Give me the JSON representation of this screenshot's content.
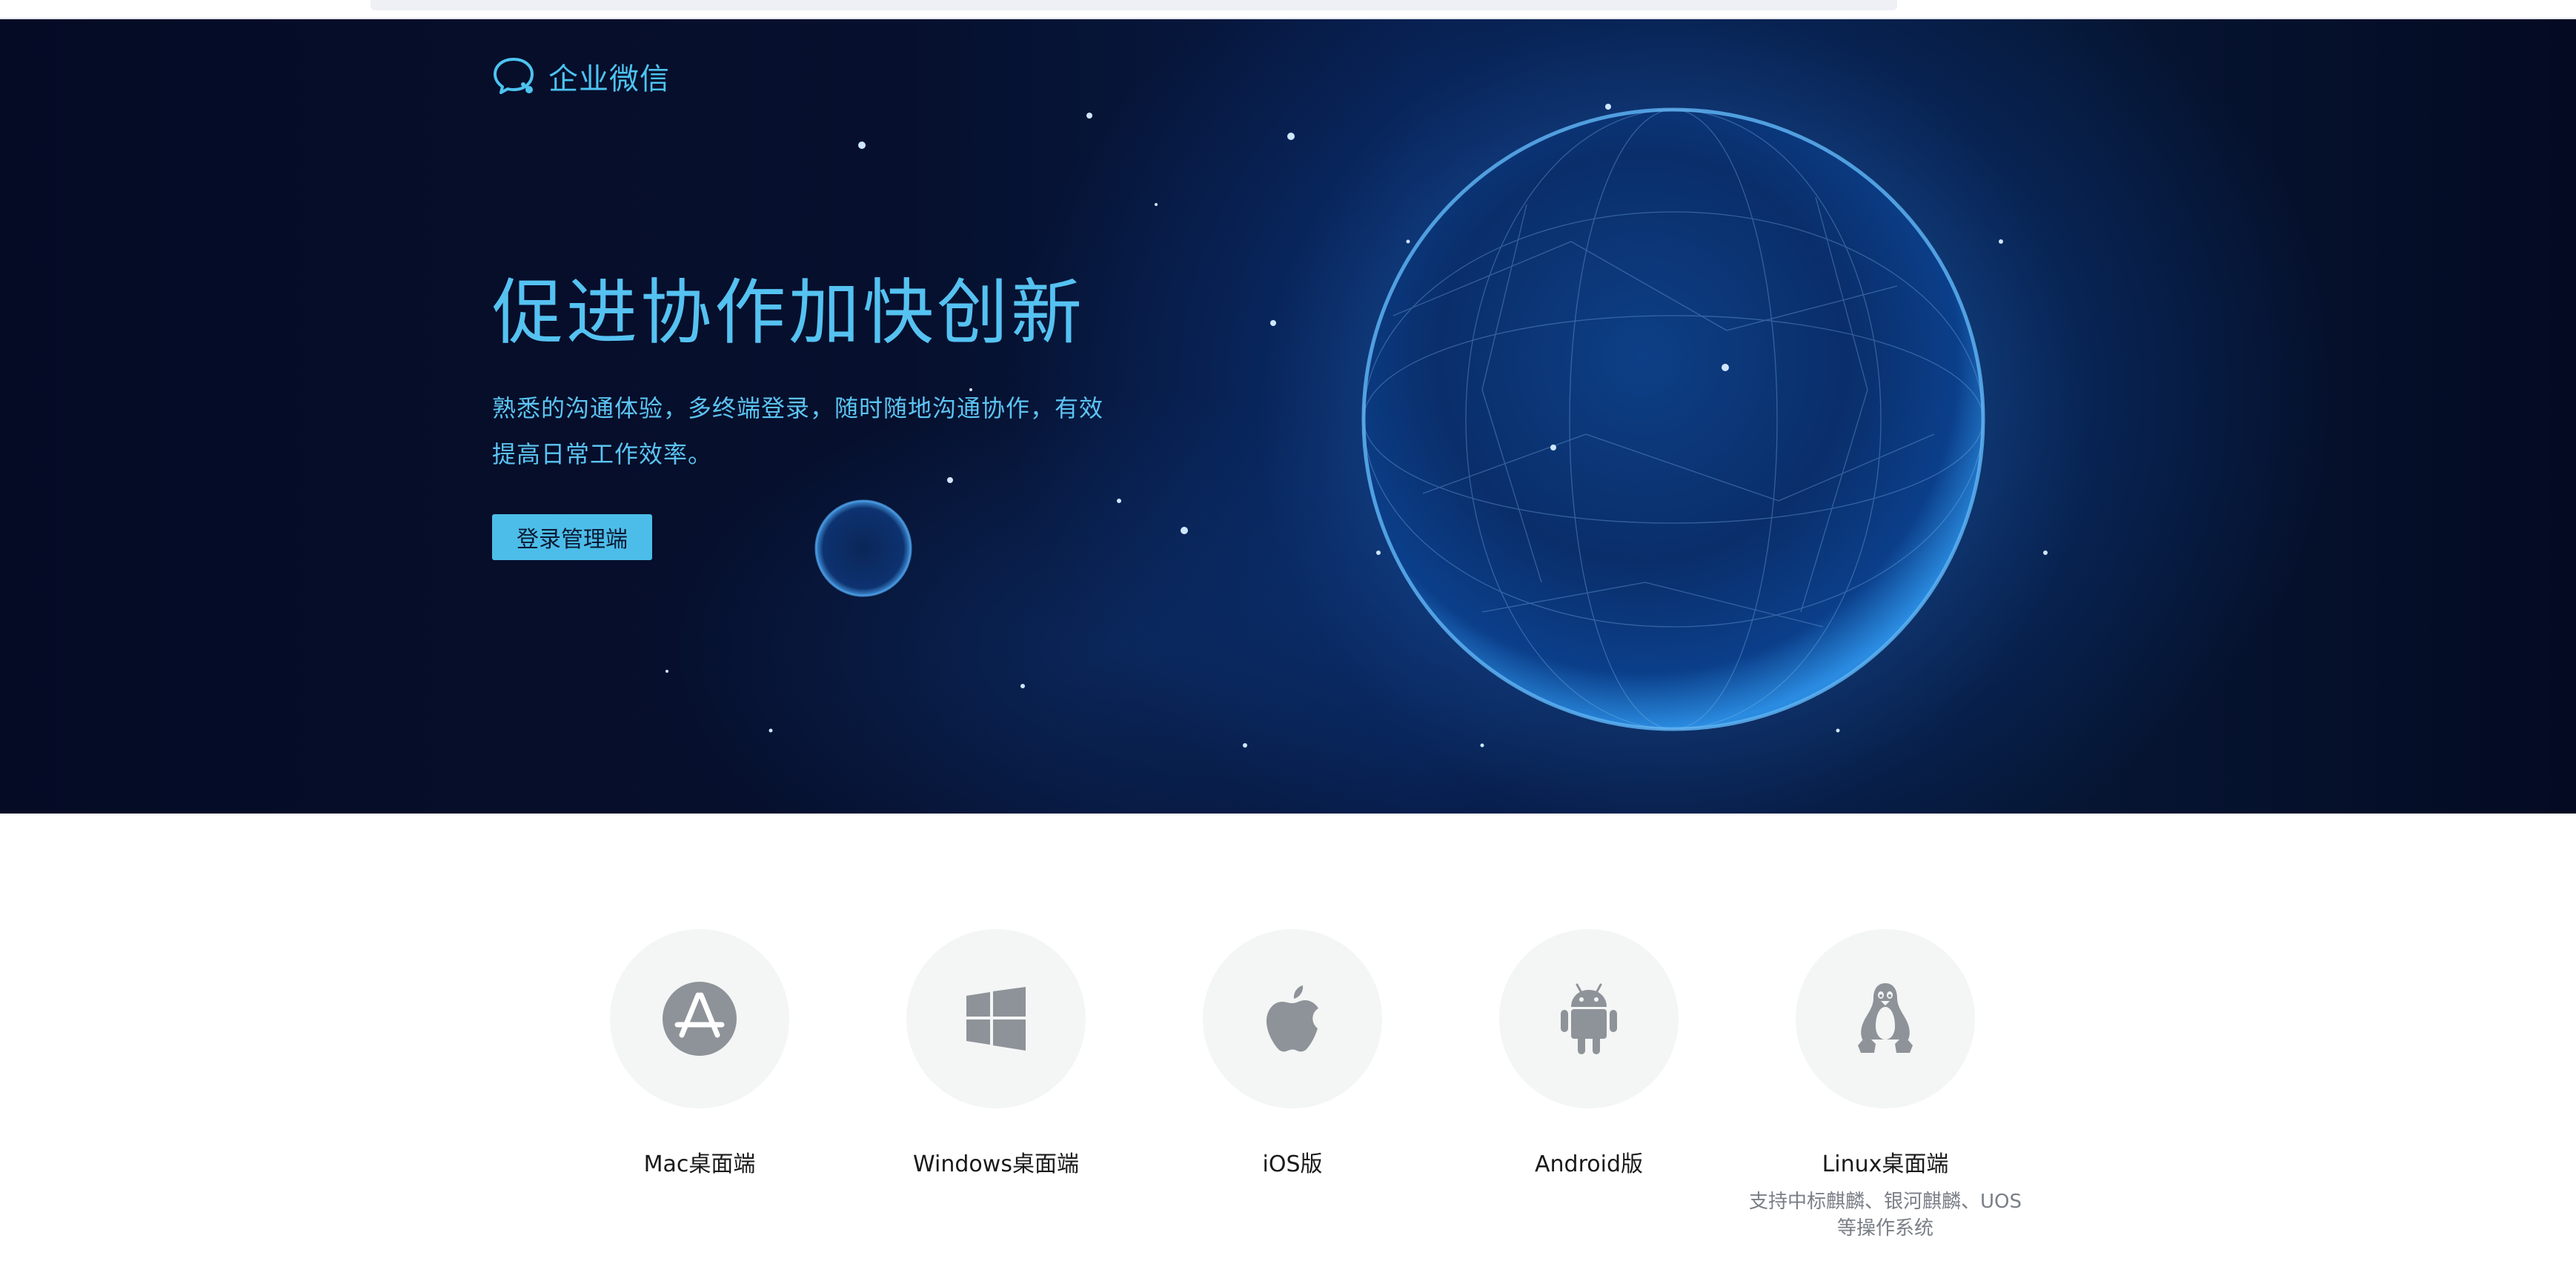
{
  "brand": {
    "name": "企业微信",
    "logo_icon": "wework-chat-logo-icon",
    "accent_color": "#4dc3f0"
  },
  "hero": {
    "title": "促进协作加快创新",
    "description": "熟悉的沟通体验，多终端登录，随时随地沟通协作，有效提高日常工作效率。",
    "login_button": "登录管理端",
    "button_color": "#4cbde9",
    "background_color": "#061030"
  },
  "platforms": [
    {
      "icon": "app-store-icon",
      "label": "Mac桌面端",
      "sub": ""
    },
    {
      "icon": "windows-icon",
      "label": "Windows桌面端",
      "sub": ""
    },
    {
      "icon": "apple-icon",
      "label": "iOS版",
      "sub": ""
    },
    {
      "icon": "android-icon",
      "label": "Android版",
      "sub": ""
    },
    {
      "icon": "linux-penguin-icon",
      "label": "Linux桌面端",
      "sub": "支持中标麒麟、银河麒麟、UOS等操作系统"
    }
  ],
  "icon_color": "#8e9399",
  "circle_color": "#f4f5f5"
}
